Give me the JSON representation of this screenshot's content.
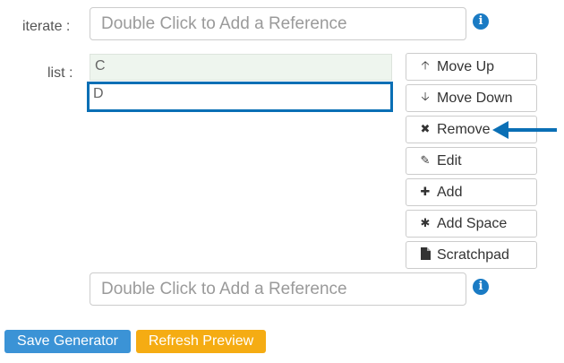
{
  "iterate": {
    "label": "iterate :",
    "placeholder": "Double Click to Add a Reference"
  },
  "list": {
    "label": "list :",
    "items": [
      "C",
      "D"
    ],
    "selected_index": 1
  },
  "buttons": {
    "move_up": "Move Up",
    "move_down": "Move Down",
    "remove": "Remove",
    "edit": "Edit",
    "add": "Add",
    "add_space": "Add Space",
    "scratchpad": "Scratchpad"
  },
  "new_reference": {
    "placeholder": "Double Click to Add a Reference"
  },
  "actions": {
    "save": "Save Generator",
    "refresh": "Refresh Preview"
  },
  "icons": {
    "info": "info-circle-icon",
    "move_up": "arrow-up-icon",
    "move_down": "arrow-down-icon",
    "remove": "times-icon",
    "edit": "pencil-icon",
    "add": "plus-icon",
    "add_space": "asterisk-icon",
    "scratchpad": "file-icon",
    "annotation": "arrow-left-icon"
  },
  "colors": {
    "accent_blue": "#0a6fb5",
    "save_button": "#3b93d6",
    "refresh_button": "#f5ac13",
    "list_item_bg": "#eef5ee"
  }
}
